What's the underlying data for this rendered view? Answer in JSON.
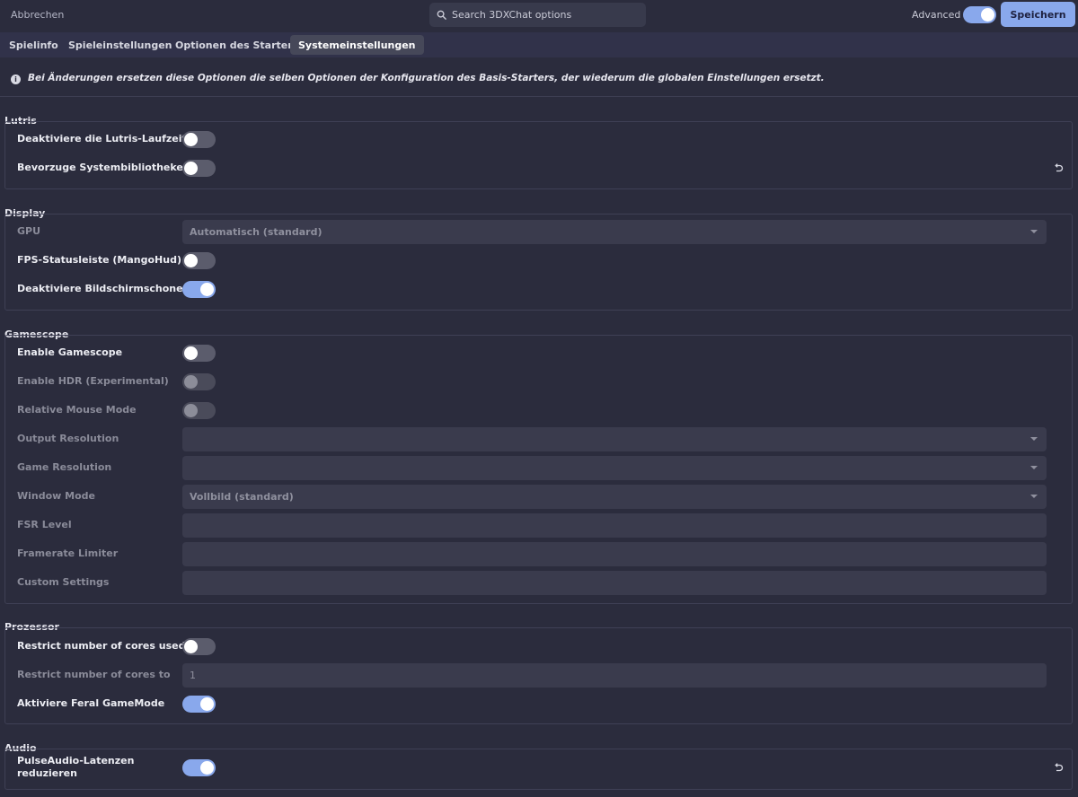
{
  "header": {
    "cancel_label": "Abbrechen",
    "search_placeholder": "Search 3DXChat options",
    "advanced_label": "Advanced",
    "advanced_on": true,
    "save_label": "Speichern"
  },
  "tabs": [
    {
      "label": "Spielinfo",
      "active": false
    },
    {
      "label": "Spieleinstellungen",
      "active": false
    },
    {
      "label": "Optionen des Starters",
      "active": false
    },
    {
      "label": "Systemeinstellungen",
      "active": true
    }
  ],
  "info": {
    "icon": "info-icon",
    "text": "Bei Änderungen ersetzen diese Optionen die selben Optionen der Konfiguration des Basis-Starters, der wiederum die globalen Einstellungen ersetzt."
  },
  "sections": {
    "lutris": {
      "title": "Lutris",
      "rows": [
        {
          "label": "Deaktiviere die Lutris-Laufzeit",
          "type": "switch",
          "on": false
        },
        {
          "label": "Bevorzuge Systembibliotheken",
          "type": "switch",
          "on": false,
          "reset": true
        }
      ]
    },
    "display": {
      "title": "Display",
      "rows": [
        {
          "label": "GPU",
          "type": "select",
          "value": "Automatisch (standard)",
          "disabled": true
        },
        {
          "label": "FPS-Statusleiste (MangoHud)",
          "type": "switch",
          "on": false
        },
        {
          "label": "Deaktiviere Bildschirmschoner",
          "type": "switch",
          "on": true
        }
      ]
    },
    "gamescope": {
      "title": "Gamescope",
      "rows": [
        {
          "label": "Enable Gamescope",
          "type": "switch",
          "on": false
        },
        {
          "label": "Enable HDR (Experimental)",
          "type": "switch",
          "on": false,
          "disabled": true
        },
        {
          "label": "Relative Mouse Mode",
          "type": "switch",
          "on": false,
          "disabled": true
        },
        {
          "label": "Output Resolution",
          "type": "select",
          "value": "",
          "disabled": true
        },
        {
          "label": "Game Resolution",
          "type": "select",
          "value": "",
          "disabled": true
        },
        {
          "label": "Window Mode",
          "type": "select",
          "value": "Vollbild (standard)",
          "disabled": true
        },
        {
          "label": "FSR Level",
          "type": "text",
          "value": "",
          "disabled": true
        },
        {
          "label": "Framerate Limiter",
          "type": "text",
          "value": "",
          "disabled": true
        },
        {
          "label": "Custom Settings",
          "type": "text",
          "value": "",
          "disabled": true
        }
      ]
    },
    "prozessor": {
      "title": "Prozessor",
      "rows": [
        {
          "label": "Restrict number of cores used",
          "type": "switch",
          "on": false
        },
        {
          "label": "Restrict number of cores to",
          "type": "text",
          "value": "1",
          "disabled": true
        },
        {
          "label": "Aktiviere Feral GameMode",
          "type": "switch",
          "on": true
        }
      ]
    },
    "audio": {
      "title": "Audio",
      "rows": [
        {
          "label_line1": "PulseAudio-Latenzen",
          "label_line2": "reduzieren",
          "type": "switch",
          "on": true,
          "reset": true
        }
      ]
    }
  },
  "colors": {
    "accent": "#89a8ec",
    "background": "#2b2c3d"
  }
}
